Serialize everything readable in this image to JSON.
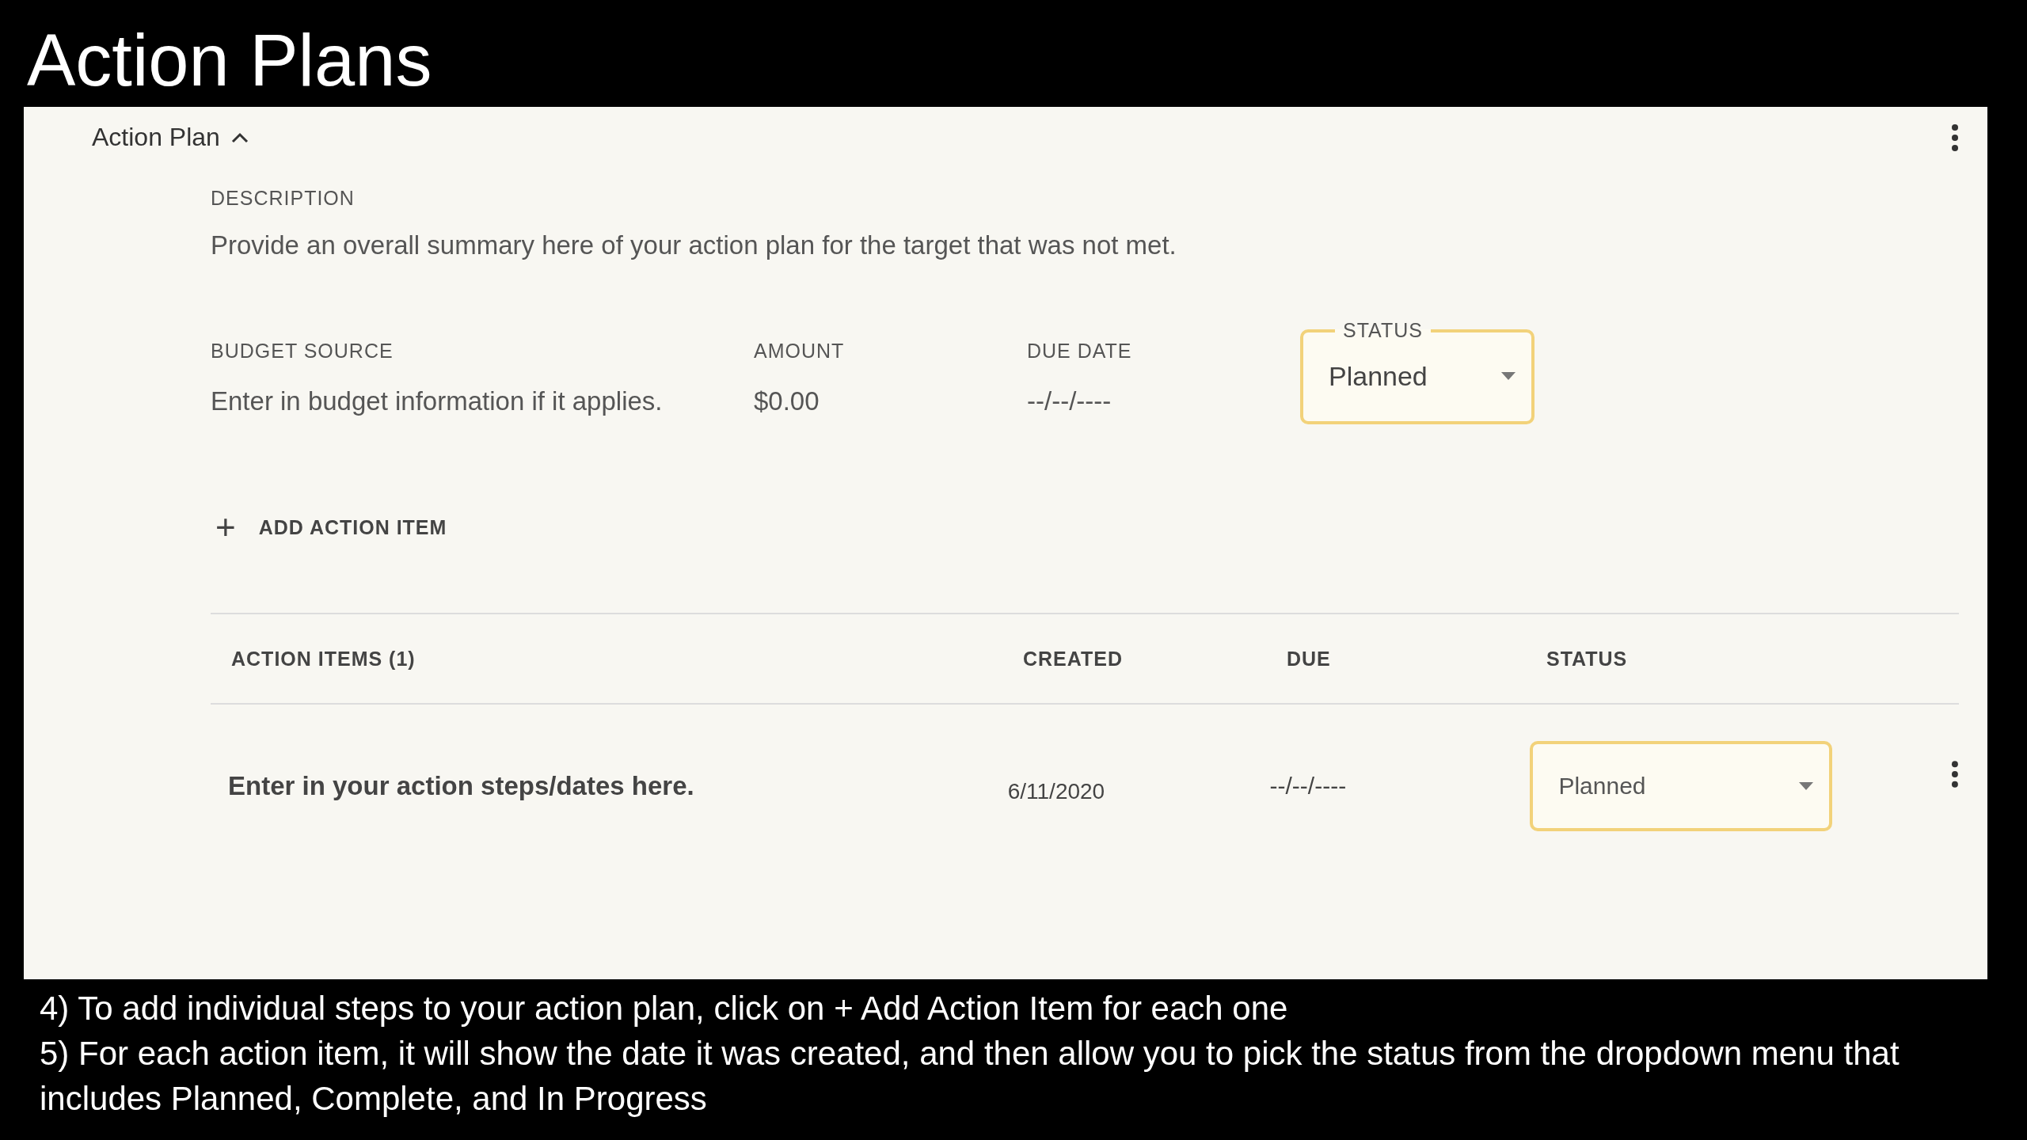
{
  "slide_title": "Action Plans",
  "panel": {
    "title": "Action Plan",
    "expanded": true,
    "description": {
      "label": "DESCRIPTION",
      "value": "Provide an overall summary here of your action plan for the target that was not met."
    },
    "fields": [
      {
        "label": "BUDGET SOURCE",
        "value": "Enter in budget information if it applies."
      },
      {
        "label": "AMOUNT",
        "value": "$0.00"
      },
      {
        "label": "DUE DATE",
        "value": "--/--/----"
      }
    ],
    "status": {
      "label": "STATUS",
      "value": "Planned"
    },
    "add_button": {
      "icon": "+",
      "label": "ADD ACTION ITEM"
    },
    "table": {
      "columns": [
        "ACTION ITEMS (1)",
        "CREATED",
        "DUE",
        "STATUS"
      ],
      "rows": [
        {
          "text": "Enter in your action steps/dates here.",
          "created": "6/11/2020",
          "due": "--/--/----",
          "status": "Planned"
        }
      ]
    }
  },
  "notes": [
    "4) To add individual steps to your action plan, click on + Add Action Item for each one",
    "5) For each action item, it will show the date it was created, and then allow you to pick the status from the dropdown menu that includes Planned, Complete, and In Progress"
  ]
}
